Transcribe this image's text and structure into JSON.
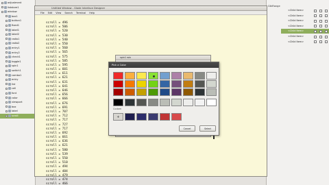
{
  "left_tree": [
    {
      "label": "adjustment",
      "selected": false
    },
    {
      "label": "liststore1",
      "selected": false
    },
    {
      "label": "window",
      "selected": false
    },
    {
      "label": "box1",
      "selected": false
    },
    {
      "label": "button1",
      "selected": false
    },
    {
      "label": "fixed1",
      "selected": false
    },
    {
      "label": "label1",
      "selected": false
    },
    {
      "label": "label2",
      "selected": false
    },
    {
      "label": "radio1",
      "selected": false
    },
    {
      "label": "radio2",
      "selected": false
    },
    {
      "label": "entry1",
      "selected": false
    },
    {
      "label": "entry2",
      "selected": false
    },
    {
      "label": "check1",
      "selected": false
    },
    {
      "label": "toggle1",
      "selected": false
    },
    {
      "label": "spin1",
      "selected": false
    },
    {
      "label": "switch1",
      "selected": false
    },
    {
      "label": "combo1",
      "selected": false
    },
    {
      "label": "entry",
      "selected": false
    },
    {
      "label": "list",
      "selected": false
    },
    {
      "label": "cell",
      "selected": false
    },
    {
      "label": "font",
      "selected": false
    },
    {
      "label": "color",
      "selected": false
    },
    {
      "label": "viewport",
      "selected": false
    },
    {
      "label": "box",
      "selected": false
    },
    {
      "label": "label",
      "selected": false
    },
    {
      "label": "scroll",
      "selected": true
    }
  ],
  "right_panel": {
    "header": "GtkRange",
    "rows": [
      {
        "label": "<Child Item>",
        "selected": false
      },
      {
        "label": "<Child Item>",
        "selected": false
      },
      {
        "label": "<Child Item>",
        "selected": false
      },
      {
        "label": "<Child Item>",
        "selected": false
      },
      {
        "label": "<Child Item>",
        "selected": true
      },
      {
        "label": "<Child Item>",
        "selected": false
      },
      {
        "label": "<Child Item>",
        "selected": false
      }
    ]
  },
  "editor": {
    "title": "Untitled Window - Glade Interface Designer",
    "menu": [
      "File",
      "Edit",
      "View",
      "Search",
      "Terminal",
      "Help"
    ],
    "lines": [
      "scroll = 496",
      "scroll = 506",
      "scroll = 520",
      "scroll = 530",
      "scroll = 540",
      "scroll = 550",
      "scroll = 560",
      "scroll = 565",
      "scroll = 575",
      "scroll = 585",
      "scroll = 595",
      "scroll = 601",
      "scroll = 611",
      "scroll = 621",
      "scroll = 631",
      "scroll = 641",
      "scroll = 646",
      "scroll = 656",
      "scroll = 666",
      "scroll = 676",
      "scroll = 691",
      "scroll = 707",
      "scroll = 712",
      "scroll = 717",
      "scroll = 727",
      "scroll = 717",
      "scroll = 692",
      "scroll = 661",
      "scroll = 636",
      "scroll = 621",
      "scroll = 580",
      "scroll = 539",
      "scroll = 550",
      "scroll = 510",
      "scroll = 494",
      "scroll = 484",
      "scroll = 479",
      "scroll = 474",
      "scroll = 466",
      "scroll = 466"
    ]
  },
  "small_window": {
    "title": "spin1 win"
  },
  "color_dialog": {
    "title": "Pick a Color",
    "custom_label": "Custom",
    "custom_add": "+",
    "cancel_label": "Cancel",
    "select_label": "Select",
    "palette": [
      [
        "#ef2929",
        "#fcaf3e",
        "#fce94f",
        "#8ae234",
        "#729fcf",
        "#ad7fa8",
        "#e9b96e",
        "#888a85",
        "#eeeeec"
      ],
      [
        "#cc0000",
        "#f57900",
        "#edd400",
        "#73d216",
        "#3465a4",
        "#75507b",
        "#c17d11",
        "#555753",
        "#d3d7cf"
      ],
      [
        "#a40000",
        "#ce5c00",
        "#c4a000",
        "#4e9a06",
        "#204a87",
        "#5c3566",
        "#8f5902",
        "#2e3436",
        "#babdb6"
      ],
      [
        "#000000",
        "#2e3436",
        "#555753",
        "#888a85",
        "#babdb6",
        "#d3d7cf",
        "#eeeeec",
        "#f3f3f3",
        "#ffffff"
      ]
    ],
    "selected": [
      0,
      3
    ],
    "custom": [
      "#1f1f4f",
      "#2c2c6a",
      "#3a3a70",
      "#c03535",
      "#d84a4a"
    ]
  }
}
